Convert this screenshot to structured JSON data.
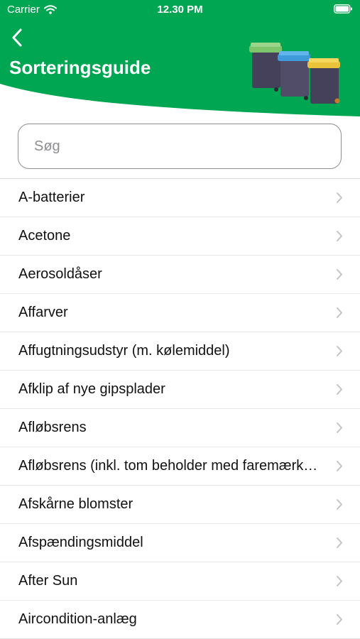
{
  "status_bar": {
    "carrier": "Carrier",
    "time": "12.30 PM",
    "wifi_icon": "wifi-icon",
    "battery_icon": "battery-icon"
  },
  "header": {
    "title": "Sorteringsguide",
    "back_icon": "chevron-left-icon",
    "bins_image": "waste-bins-illustration",
    "accent_color": "#00a651"
  },
  "search": {
    "placeholder": "Søg",
    "value": ""
  },
  "list": {
    "chevron_icon": "chevron-right-icon",
    "items": [
      {
        "label": "A-batterier"
      },
      {
        "label": "Acetone"
      },
      {
        "label": "Aerosoldåser"
      },
      {
        "label": "Affarver"
      },
      {
        "label": "Affugtningsudstyr (m. kølemiddel)"
      },
      {
        "label": "Afklip af nye gipsplader"
      },
      {
        "label": "Afløbsrens"
      },
      {
        "label": "Afløbsrens (inkl. tom beholder med faremærkning)"
      },
      {
        "label": "Afskårne blomster"
      },
      {
        "label": "Afspændingsmiddel"
      },
      {
        "label": "After Sun"
      },
      {
        "label": "Aircondition-anlæg"
      }
    ]
  }
}
